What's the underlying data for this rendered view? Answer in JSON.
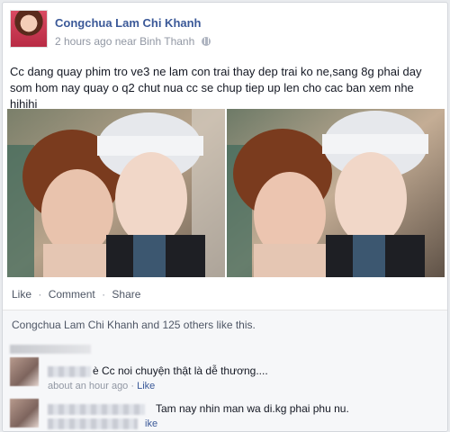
{
  "post": {
    "author": "Congchua Lam Chi Khanh",
    "time": "2 hours ago",
    "location_prefix": "near",
    "location": "Binh Thanh",
    "text": "Cc dang quay phim tro ve3 ne lam con trai thay dep trai ko ne,sang 8g phai day som hom nay quay o q2 chut nua cc se chup tiep up len cho cac ban xem nhe hihihi"
  },
  "actions": {
    "like": "Like",
    "comment": "Comment",
    "share": "Share",
    "separator": "·"
  },
  "likes": {
    "summary": "Congchua Lam Chi Khanh and 125 others like this."
  },
  "comments": [
    {
      "text": "è Cc noi chuyện thật là dễ thương....",
      "time": "about an hour ago",
      "separator": "·",
      "like": "Like"
    },
    {
      "text": "Tam nay nhin man wa di.kg phai phu nu.",
      "like_partial": "ike"
    }
  ],
  "colors": {
    "link": "#3b5998",
    "muted": "#9197a3",
    "text": "#141823"
  },
  "icons": [
    "globe-icon"
  ]
}
